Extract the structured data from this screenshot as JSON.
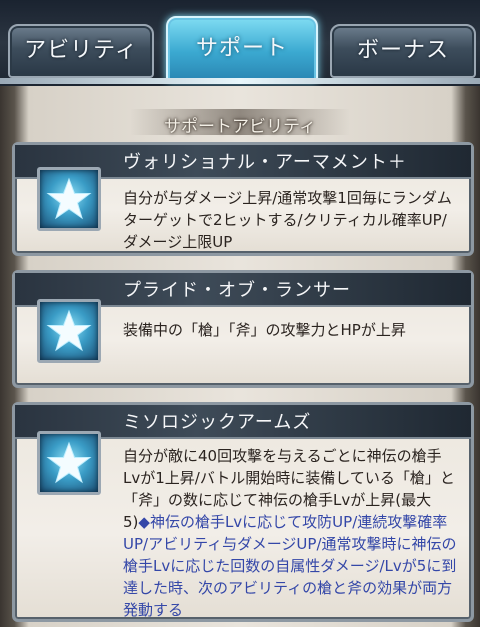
{
  "tabs": [
    {
      "label": "アビリティ",
      "active": false
    },
    {
      "label": "サポート",
      "active": true
    },
    {
      "label": "ボーナス",
      "active": false
    }
  ],
  "section_title": "サポートアビリティ",
  "abilities": [
    {
      "name": "ヴォリショナル・アーマメント＋",
      "icon": "star-icon",
      "description": "自分が与ダメージ上昇/通常攻撃1回毎にランダムターゲットで2ヒットする/クリティカル確率UP/ダメージ上限UP"
    },
    {
      "name": "プライド・オブ・ランサー",
      "icon": "star-icon",
      "description": "装備中の「槍」「斧」の攻撃力とHPが上昇"
    },
    {
      "name": "ミソロジックアームズ",
      "icon": "star-icon",
      "description": "自分が敵に40回攻撃を与えるごとに神伝の槍手Lvが1上昇/バトル開始時に装備している「槍」と「斧」の数に応じて神伝の槍手Lvが上昇(最大5)",
      "note": "◆神伝の槍手Lvに応じて攻防UP/連続攻撃確率UP/アビリティ与ダメージUP/通常攻撃時に神伝の槍手Lvに応じた回数の自属性ダメージ/Lvが5に到達した時、次のアビリティの槍と斧の効果が両方発動する"
    }
  ],
  "colors": {
    "active_tab": "#3ba9d1",
    "card_header": "#2a3440",
    "note_text": "#3447a8"
  }
}
